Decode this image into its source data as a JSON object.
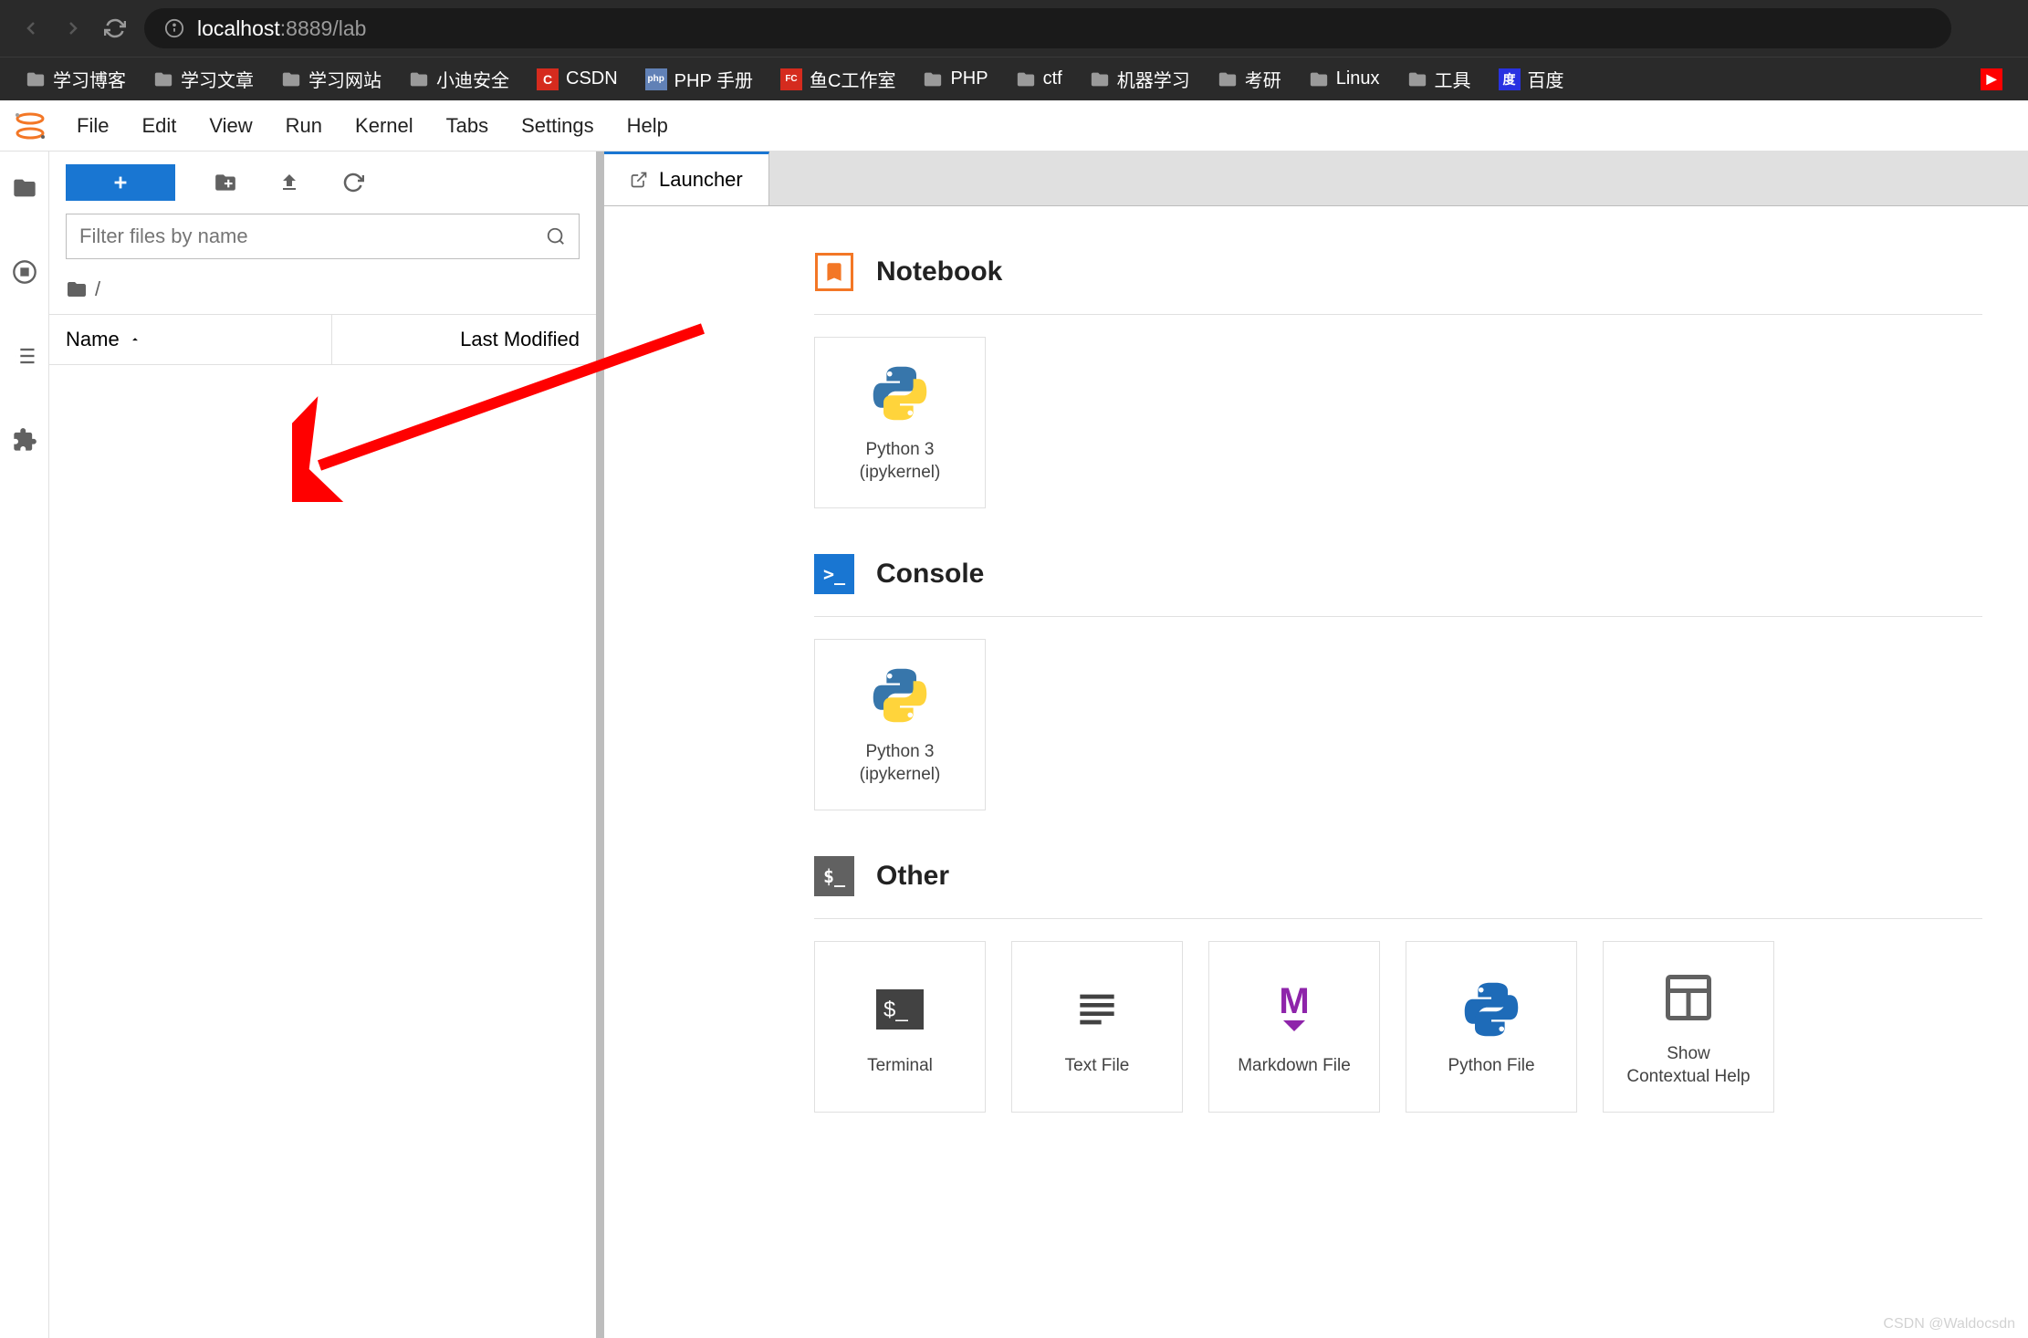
{
  "browser": {
    "url_host": "localhost",
    "url_port_path": ":8889/lab",
    "bookmarks": [
      {
        "label": "学习博客",
        "type": "folder"
      },
      {
        "label": "学习文章",
        "type": "folder"
      },
      {
        "label": "学习网站",
        "type": "folder"
      },
      {
        "label": "小迪安全",
        "type": "folder"
      },
      {
        "label": "CSDN",
        "type": "icon",
        "bg": "#d52b1e",
        "letter": "C"
      },
      {
        "label": "PHP 手册",
        "type": "icon",
        "bg": "#6181b6",
        "letter": "php"
      },
      {
        "label": "鱼C工作室",
        "type": "icon",
        "bg": "#d52b1e",
        "letter": "FC"
      },
      {
        "label": "PHP",
        "type": "folder"
      },
      {
        "label": "ctf",
        "type": "folder"
      },
      {
        "label": "机器学习",
        "type": "folder"
      },
      {
        "label": "考研",
        "type": "folder"
      },
      {
        "label": "Linux",
        "type": "folder"
      },
      {
        "label": "工具",
        "type": "folder"
      },
      {
        "label": "百度",
        "type": "icon",
        "bg": "#2932e1",
        "letter": "度"
      }
    ]
  },
  "menubar": {
    "items": [
      "File",
      "Edit",
      "View",
      "Run",
      "Kernel",
      "Tabs",
      "Settings",
      "Help"
    ]
  },
  "filebrowser": {
    "filter_placeholder": "Filter files by name",
    "breadcrumb_root": "/",
    "col_name": "Name",
    "col_modified": "Last Modified"
  },
  "tab": {
    "title": "Launcher"
  },
  "launcher": {
    "sections": [
      {
        "title": "Notebook",
        "icon_bg": "#fff",
        "icon_border": "#f37726",
        "icon_type": "notebook",
        "cards": [
          {
            "label": "Python 3\n(ipykernel)",
            "icon": "python"
          }
        ]
      },
      {
        "title": "Console",
        "icon_bg": "#1976d2",
        "icon_type": "console",
        "cards": [
          {
            "label": "Python 3\n(ipykernel)",
            "icon": "python"
          }
        ]
      },
      {
        "title": "Other",
        "icon_bg": "#616161",
        "icon_type": "terminal",
        "cards": [
          {
            "label": "Terminal",
            "icon": "terminal"
          },
          {
            "label": "Text File",
            "icon": "text"
          },
          {
            "label": "Markdown File",
            "icon": "markdown"
          },
          {
            "label": "Python File",
            "icon": "python-blue"
          },
          {
            "label": "Show\nContextual Help",
            "icon": "help"
          }
        ]
      }
    ]
  },
  "watermark": "CSDN @Waldocsdn"
}
